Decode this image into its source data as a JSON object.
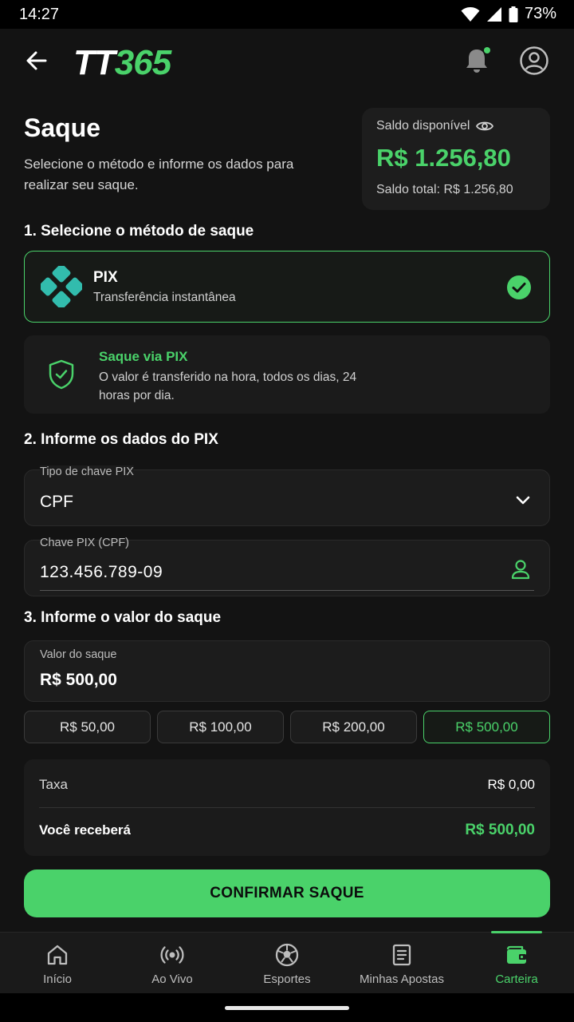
{
  "status_bar": {
    "time": "14:27",
    "battery": "73%",
    "icons": [
      "wifi-icon",
      "signal-icon",
      "battery-icon"
    ]
  },
  "header": {
    "logo_part1": "TT",
    "logo_part2": "365",
    "icons": [
      "back-arrow-icon",
      "bell-icon",
      "profile-icon"
    ]
  },
  "page": {
    "title": "Saque",
    "subtitle": "Selecione o método e informe os dados para realizar seu saque."
  },
  "balance": {
    "label": "Saldo disponível",
    "value": "R$ 1.256,80",
    "total": "Saldo total: R$ 1.256,80"
  },
  "sections": {
    "method": "1. Selecione o método de saque",
    "pix_data": "2. Informe os dados do PIX",
    "amount": "3. Informe o valor do saque"
  },
  "method_card": {
    "name": "PIX",
    "description": "Transferência instantânea",
    "selected": true
  },
  "info_card": {
    "title": "Saque via PIX",
    "text": "O valor é transferido na hora, todos os dias, 24 horas por dia."
  },
  "fields": {
    "key_type": {
      "label": "Tipo de chave PIX",
      "value": "CPF"
    },
    "key": {
      "label": "Chave PIX (CPF)",
      "value": "123.456.789-09"
    },
    "amount": {
      "label": "Valor do saque",
      "value": "R$ 500,00"
    }
  },
  "quick_amounts": [
    "R$ 50,00",
    "R$ 100,00",
    "R$ 200,00",
    "R$ 500,00"
  ],
  "summary": {
    "fee_label": "Taxa",
    "fee_value": "R$ 0,00",
    "receive_label": "Você receberá",
    "receive_value": "R$ 500,00"
  },
  "confirm_button": "CONFIRMAR SAQUE",
  "bottom_nav": {
    "items": [
      {
        "label": "Início",
        "icon": "home-icon"
      },
      {
        "label": "Ao Vivo",
        "icon": "live-icon"
      },
      {
        "label": "Esportes",
        "icon": "soccer-ball-icon"
      },
      {
        "label": "Minhas Apostas",
        "icon": "bets-document-icon"
      },
      {
        "label": "Carteira",
        "icon": "wallet-icon"
      }
    ],
    "active": "Carteira"
  },
  "colors": {
    "accent": "#4ad26a",
    "background": "#131313",
    "card": "#1c1c1c"
  }
}
